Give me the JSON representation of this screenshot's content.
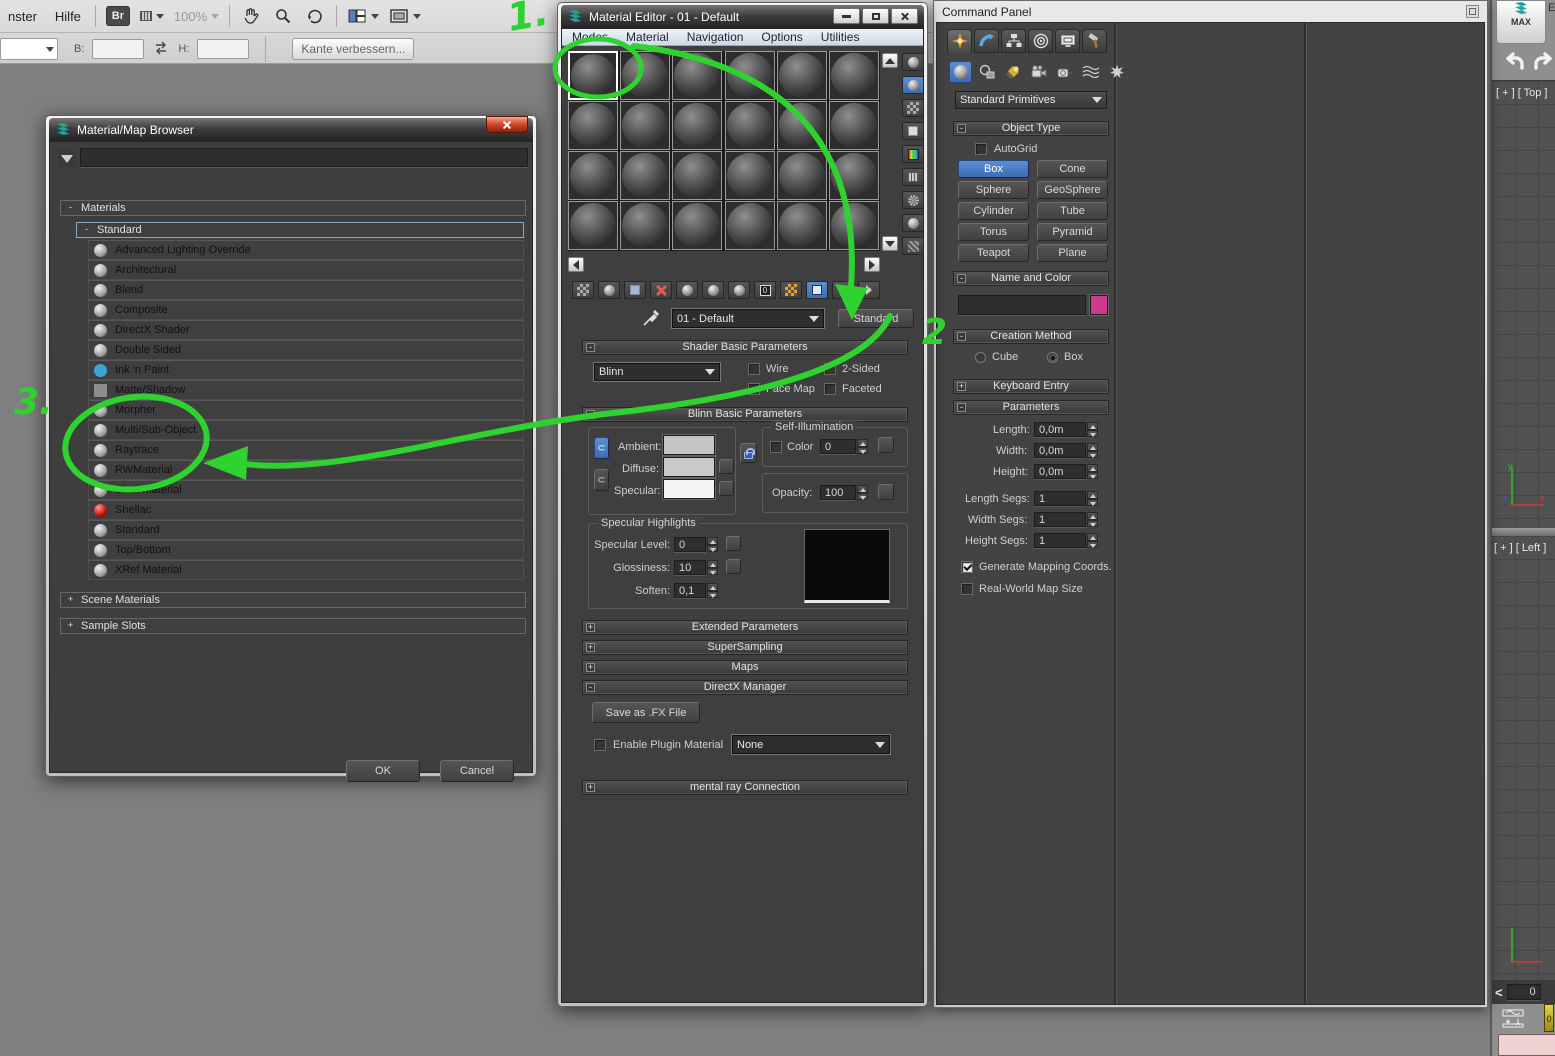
{
  "ps_toolbar": {
    "menu_fenster": "nster",
    "menu_hilfe": "Hilfe",
    "bridge_button": "Br",
    "zoom_value": "100%",
    "b_label": "B:",
    "h_label": "H:",
    "refine_edge_button": "Kante verbessern..."
  },
  "browser": {
    "title": "Material/Map Browser",
    "search_value": "",
    "materials_group": "Materials",
    "standard_group": "Standard",
    "items": [
      {
        "label": "Advanced Lighting Override",
        "icon": "sphere"
      },
      {
        "label": "Architectural",
        "icon": "sphere"
      },
      {
        "label": "Blend",
        "icon": "sphere"
      },
      {
        "label": "Composite",
        "icon": "sphere"
      },
      {
        "label": "DirectX Shader",
        "icon": "sphere"
      },
      {
        "label": "Double Sided",
        "icon": "sphere"
      },
      {
        "label": "Ink 'n Paint",
        "icon": "ink-blue"
      },
      {
        "label": "Matte/Shadow",
        "icon": "matte-square"
      },
      {
        "label": "Morpher",
        "icon": "sphere"
      },
      {
        "label": "Multi/Sub-Object",
        "icon": "sphere"
      },
      {
        "label": "Raytrace",
        "icon": "sphere"
      },
      {
        "label": "RWMaterial",
        "icon": "sphere"
      },
      {
        "label": "Shell Material",
        "icon": "sphere"
      },
      {
        "label": "Shellac",
        "icon": "shellac-red"
      },
      {
        "label": "Standard",
        "icon": "sphere"
      },
      {
        "label": "Top/Bottom",
        "icon": "sphere"
      },
      {
        "label": "XRef Material",
        "icon": "sphere"
      }
    ],
    "scene_materials_group": "Scene Materials",
    "sample_slots_group": "Sample Slots",
    "ok_button": "OK",
    "cancel_button": "Cancel"
  },
  "material_editor": {
    "title": "Material Editor - 01 - Default",
    "menus": {
      "modes": "Modes",
      "material": "Material",
      "navigation": "Navigation",
      "options": "Options",
      "utilities": "Utilities"
    },
    "material_name": "01 - Default",
    "type_button": "Standard",
    "shader_basic": {
      "header": "Shader Basic Parameters",
      "shader": "Blinn",
      "wire": "Wire",
      "two_sided": "2-Sided",
      "face_map": "Face Map",
      "faceted": "Faceted"
    },
    "blinn_basic": {
      "header": "Blinn Basic Parameters",
      "ambient_label": "Ambient:",
      "diffuse_label": "Diffuse:",
      "specular_label": "Specular:",
      "ambient_color": "#c4c4c4",
      "diffuse_color": "#c9c9c9",
      "specular_color": "#f4f4f4",
      "self_illum_header": "Self-Illumination",
      "color_label": "Color",
      "color_value": "0",
      "opacity_label": "Opacity:",
      "opacity_value": "100"
    },
    "specular_highlights": {
      "header": "Specular Highlights",
      "specular_level_label": "Specular Level:",
      "specular_level": "0",
      "glossiness_label": "Glossiness:",
      "glossiness": "10",
      "soften_label": "Soften:",
      "soften": "0,1"
    },
    "rollout_extended": "Extended Parameters",
    "rollout_supersampling": "SuperSampling",
    "rollout_maps": "Maps",
    "rollout_directx": "DirectX Manager",
    "rollout_mental_ray": "mental ray Connection",
    "directx": {
      "save_fx_button": "Save as .FX File",
      "enable_plugin_label": "Enable Plugin Material",
      "plugin_value": "None"
    }
  },
  "command_panel": {
    "title": "Command Panel",
    "category_dropdown": "Standard Primitives",
    "object_type": {
      "header": "Object Type",
      "autogrid_label": "AutoGrid",
      "buttons": [
        {
          "label": "Box",
          "active": true
        },
        {
          "label": "Cone",
          "active": false
        },
        {
          "label": "Sphere",
          "active": false
        },
        {
          "label": "GeoSphere",
          "active": false
        },
        {
          "label": "Cylinder",
          "active": false
        },
        {
          "label": "Tube",
          "active": false
        },
        {
          "label": "Torus",
          "active": false
        },
        {
          "label": "Pyramid",
          "active": false
        },
        {
          "label": "Teapot",
          "active": false
        },
        {
          "label": "Plane",
          "active": false
        }
      ]
    },
    "name_and_color": {
      "header": "Name and Color",
      "name_value": "",
      "swatch_color": "#cc3a8c"
    },
    "creation_method": {
      "header": "Creation Method",
      "cube_label": "Cube",
      "box_label": "Box"
    },
    "keyboard_entry_header": "Keyboard Entry",
    "parameters": {
      "header": "Parameters",
      "length_label": "Length:",
      "length_value": "0,0m",
      "width_label": "Width:",
      "width_value": "0,0m",
      "height_label": "Height:",
      "height_value": "0,0m",
      "length_segs_label": "Length Segs:",
      "length_segs_value": "1",
      "width_segs_label": "Width Segs:",
      "width_segs_value": "1",
      "height_segs_label": "Height Segs:",
      "height_segs_value": "1",
      "gen_mapping_label": "Generate Mapping Coords.",
      "real_world_label": "Real-World Map Size"
    }
  },
  "max_window": {
    "logo_label": "MAX",
    "edit_menu": "Ed",
    "top_viewport_label": "[ + ] [ Top ]",
    "left_viewport_label": "[ + ] [ Left ]",
    "prev_frame_button": "<",
    "frame_value": "0",
    "slider_value": "0"
  },
  "annotations": {
    "step1": "1.",
    "step2": "2",
    "step3": "3."
  }
}
